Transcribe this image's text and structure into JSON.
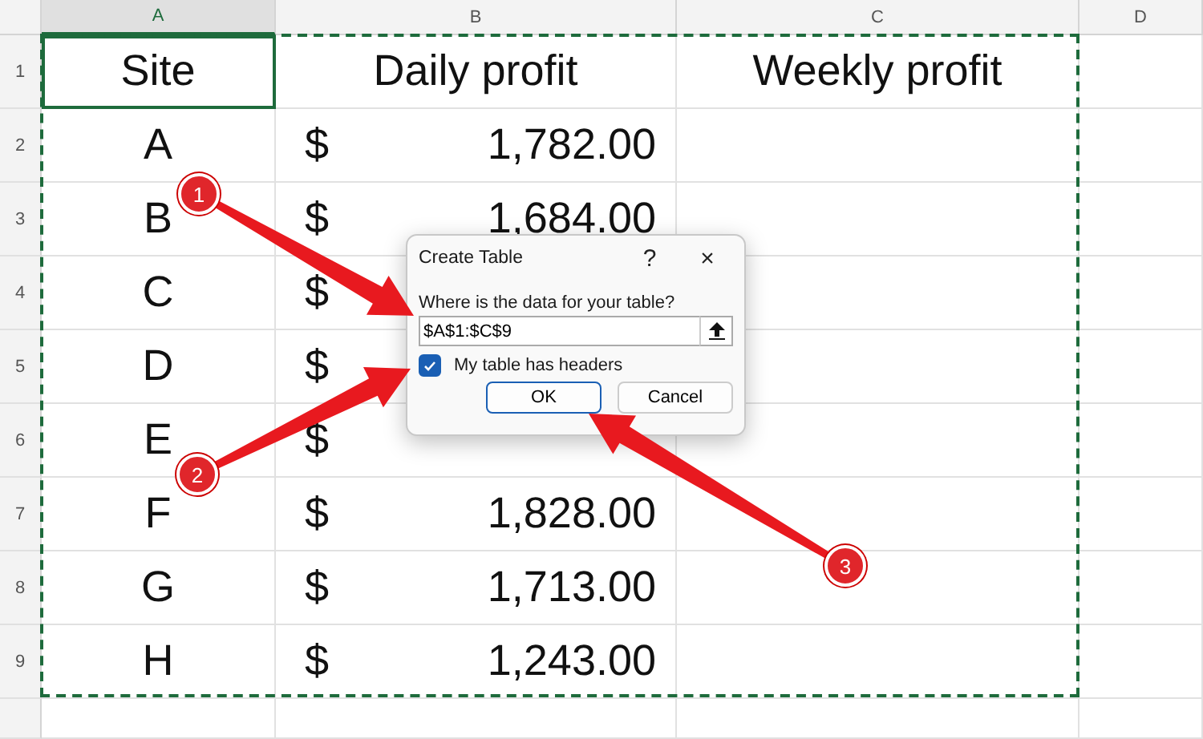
{
  "columns": [
    "A",
    "B",
    "C",
    "D"
  ],
  "header_row": {
    "number": "1",
    "cells": [
      {
        "text": "Site",
        "selected": true
      },
      {
        "text": "Daily profit",
        "selected": false
      },
      {
        "text": "Weekly profit",
        "selected": false
      }
    ]
  },
  "rows": [
    {
      "number": "2",
      "site": "A",
      "currency": "$",
      "amount": "1,782.00"
    },
    {
      "number": "3",
      "site": "B",
      "currency": "$",
      "amount": "1,684.00"
    },
    {
      "number": "4",
      "site": "C",
      "currency": "$"
    },
    {
      "number": "5",
      "site": "D",
      "currency": "$"
    },
    {
      "number": "6",
      "site": "E",
      "currency": "$"
    },
    {
      "number": "7",
      "site": "F",
      "currency": "$",
      "amount": "1,828.00"
    },
    {
      "number": "8",
      "site": "G",
      "currency": "$",
      "amount": "1,713.00"
    },
    {
      "number": "9",
      "site": "H",
      "currency": "$",
      "amount": "1,243.00"
    }
  ],
  "dialog": {
    "title": "Create Table",
    "help": "?",
    "close": "×",
    "prompt": "Where is the data for your table?",
    "range": "$A$1:$C$9",
    "headers_label": "My table has headers",
    "headers_checked": true,
    "buttons": [
      {
        "label": "OK",
        "focused": true
      },
      {
        "label": "Cancel",
        "focused": false
      }
    ]
  },
  "callouts": [
    "1",
    "2",
    "3"
  ]
}
